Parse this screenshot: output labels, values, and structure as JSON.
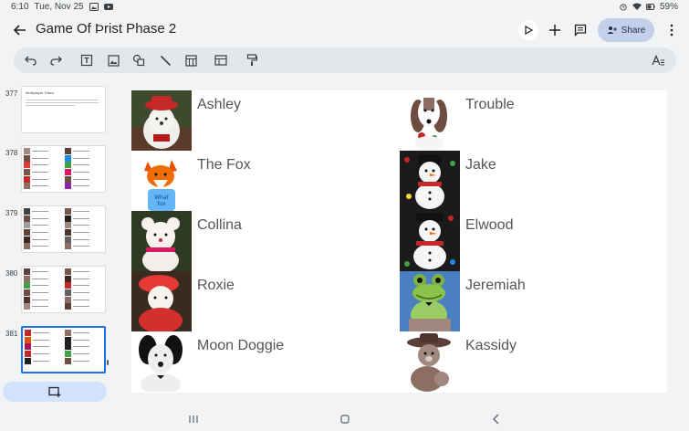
{
  "status": {
    "time": "6:10",
    "date": "Tue, Nov 25",
    "battery": "59%"
  },
  "header": {
    "title": "Game Of Þrist Phase 2",
    "share_label": "Share"
  },
  "filmstrip": {
    "slides": [
      {
        "number": "377",
        "title": "Multiplayer Token"
      },
      {
        "number": "378"
      },
      {
        "number": "379"
      },
      {
        "number": "380"
      },
      {
        "number": "381"
      }
    ]
  },
  "slide": {
    "left_column": [
      {
        "name": "Ashley",
        "photo": "red-hat-bear"
      },
      {
        "name": "The Fox",
        "photo": "fox-plush"
      },
      {
        "name": "Collina",
        "photo": "pink-bear"
      },
      {
        "name": "Roxie",
        "photo": "red-feather-bear"
      },
      {
        "name": "Moon Doggie",
        "photo": "black-dog"
      }
    ],
    "right_column": [
      {
        "name": "Trouble",
        "photo": "basset-hound"
      },
      {
        "name": "Jake",
        "photo": "snowman-plush"
      },
      {
        "name": "Elwood",
        "photo": "snowman-plush-2"
      },
      {
        "name": "Jeremiah",
        "photo": "frog-plush"
      },
      {
        "name": "Kassidy",
        "photo": "cowboy-bear"
      }
    ]
  },
  "colors": {
    "accent": "#1a73e8",
    "share_bg": "#c2d0ea",
    "toolbar_bg": "#e3e7ec"
  }
}
